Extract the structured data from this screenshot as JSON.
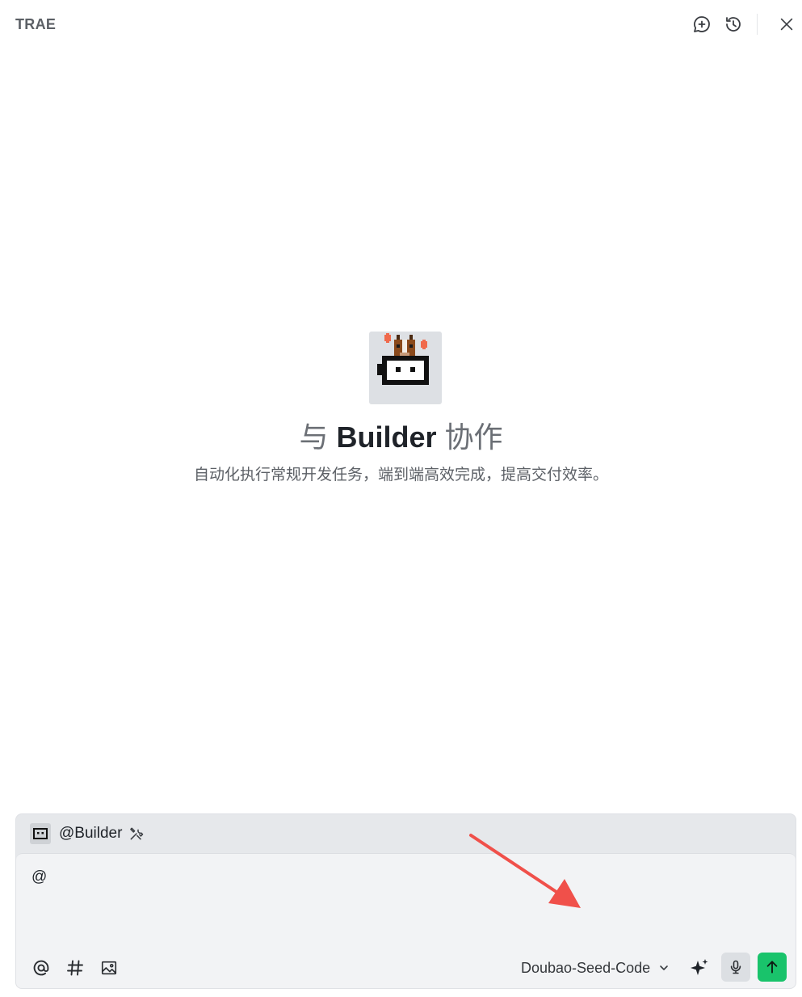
{
  "header": {
    "app_title": "TRAE",
    "icons": [
      "new-chat-icon",
      "history-icon",
      "close-icon"
    ]
  },
  "hero": {
    "title_prefix": "与",
    "title_name": "Builder",
    "title_suffix": "协作",
    "subtitle": "自动化执行常规开发任务，端到端高效完成，提高交付效率。"
  },
  "composer": {
    "agent_label": "@Builder",
    "agent_tools_icon": "tools-icon",
    "input_value": "@",
    "toolbar_icons": [
      "mention-icon",
      "hash-icon",
      "image-icon",
      "sparkle-icon",
      "mic-icon",
      "send-arrow-icon"
    ],
    "model_name": "Doubao-Seed-Code"
  },
  "colors": {
    "send_button": "#19c36b",
    "annotation_arrow": "#f0504a",
    "composer_bg": "#f2f3f5",
    "agent_bar_bg": "#e6e8eb"
  }
}
